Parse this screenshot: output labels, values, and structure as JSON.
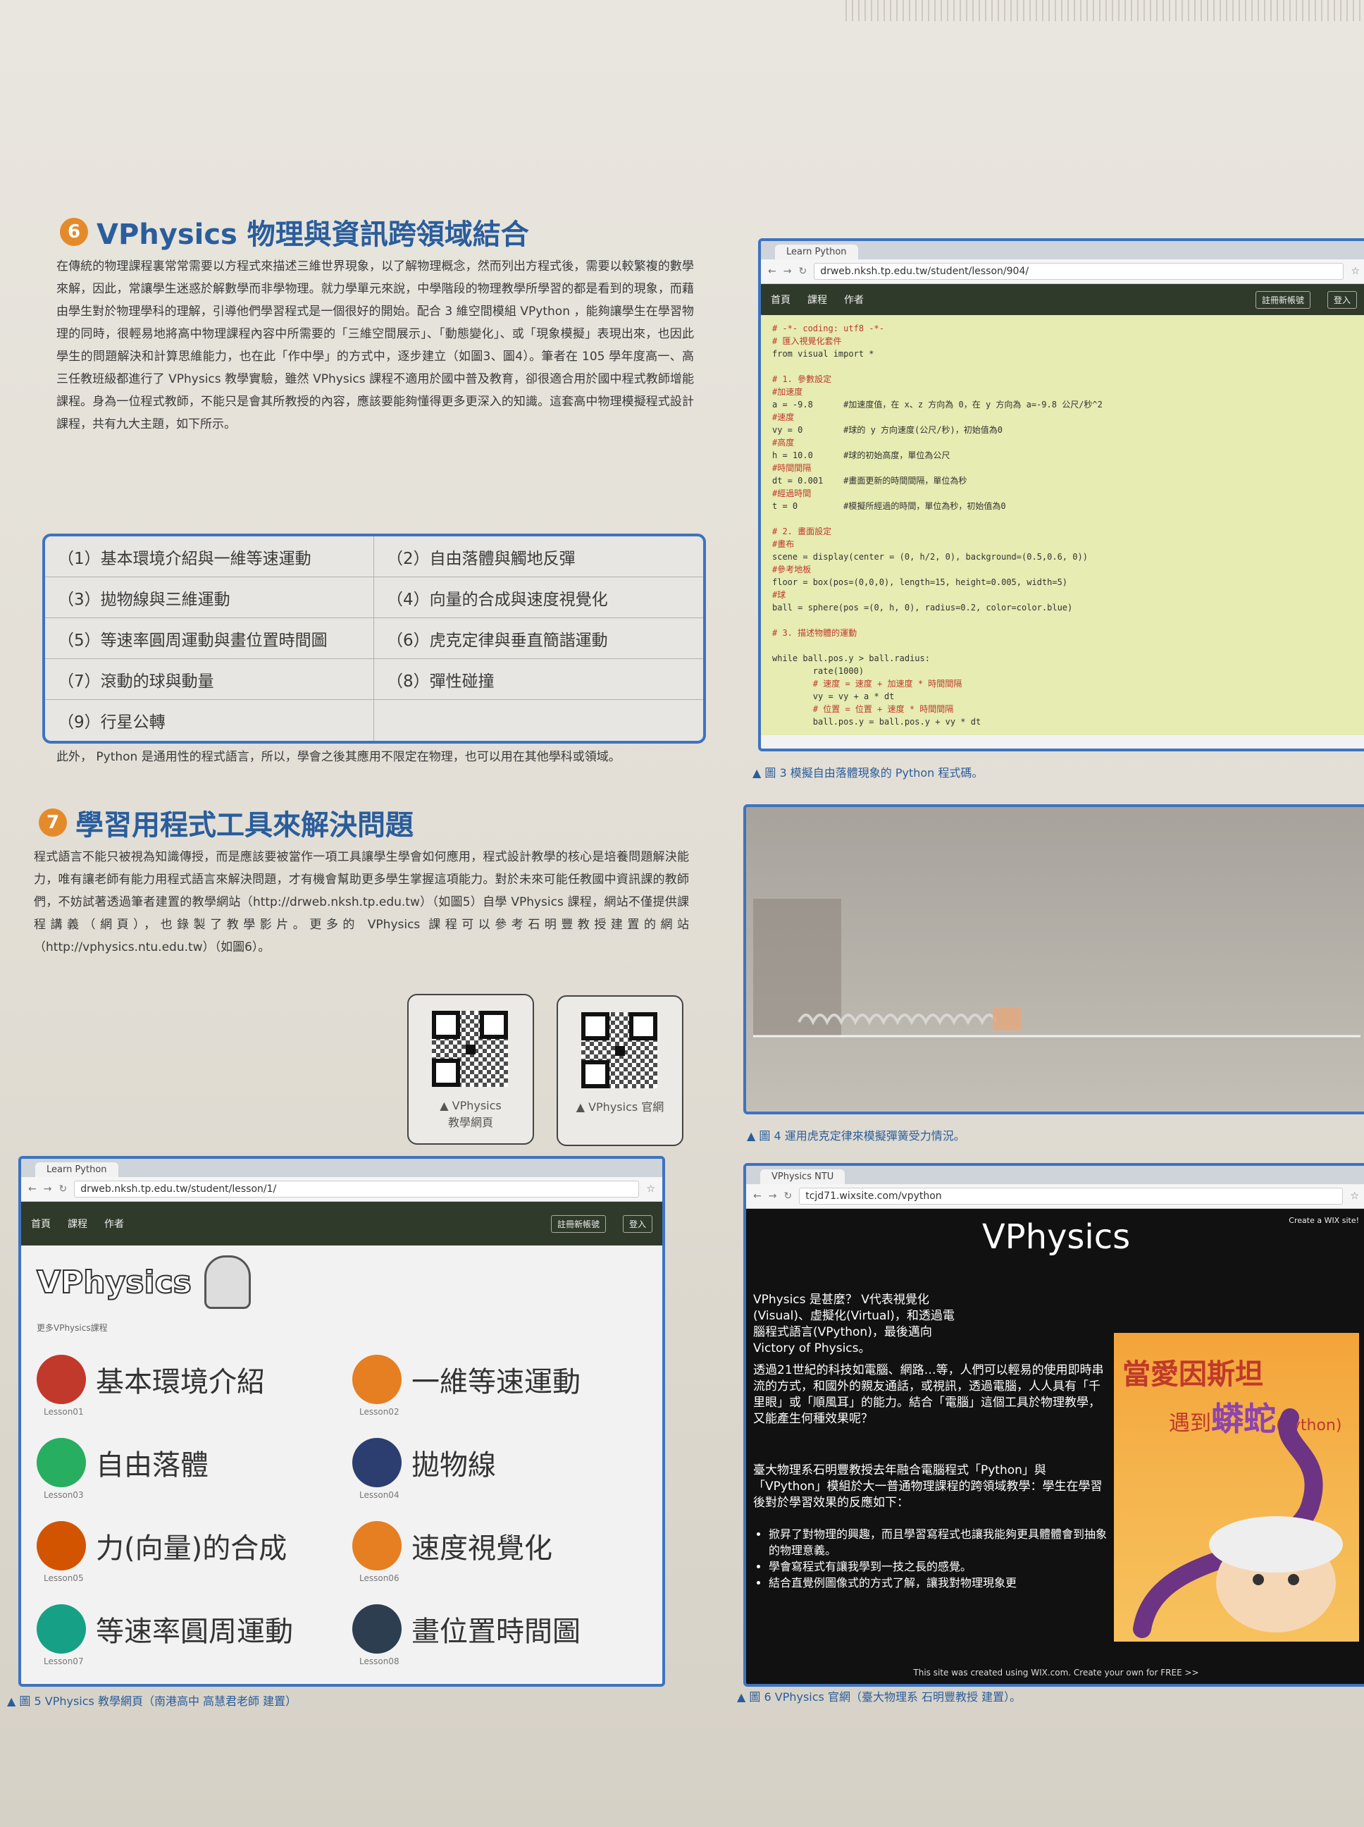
{
  "section6": {
    "number": "6",
    "title": "VPhysics 物理與資訊跨領域結合",
    "paragraph": "在傳統的物理課程裏常常需要以方程式來描述三維世界現象，以了解物理概念，然而列出方程式後，需要以較繁複的數學來解，因此，常讓學生迷惑於解數學而非學物理。就力學單元來說，中學階段的物理教學所學習的都是看到的現象，而藉由學生對於物理學科的理解，引導他們學習程式是一個很好的開始。配合 3 維空間模組 VPython ，能夠讓學生在學習物理的同時，很輕易地將高中物理課程內容中所需要的「三維空間展示」、「動態變化」、或「現象模擬」表現出來，也因此學生的問題解決和計算思維能力，也在此「作中學」的方式中，逐步建立（如圖3、圖4）。筆者在 105 學年度高一、高三任教班級都進行了 VPhysics 教學實驗，雖然 VPhysics 課程不適用於國中普及教育，卻很適合用於國中程式教師增能課程。身為一位程式教師，不能只是會其所教授的內容，應該要能夠懂得更多更深入的知識。這套高中物理模擬程式設計課程，共有九大主題，如下所示。"
  },
  "topics": [
    "（1）基本環境介紹與一維等速運動",
    "（2）自由落體與觸地反彈",
    "（3）拋物線與三維運動",
    "（4）向量的合成與速度視覺化",
    "（5）等速率圓周運動與畫位置時間圖",
    "（6）虎克定律與垂直簡諧運動",
    "（7）滾動的球與動量",
    "（8）彈性碰撞",
    "（9）行星公轉",
    ""
  ],
  "after_topics": "此外， Python 是通用性的程式語言，所以，學會之後其應用不限定在物理，也可以用在其他學科或領域。",
  "section7": {
    "number": "7",
    "title": "學習用程式工具來解決問題",
    "paragraph": "程式語言不能只被視為知識傳授，而是應該要被當作一項工具讓學生學會如何應用，程式設計教學的核心是培養問題解決能力，唯有讓老師有能力用程式語言來解決問題，才有機會幫助更多學生掌握這項能力。對於未來可能任教國中資訊課的教師們，不妨試著透過筆者建置的教學網站（http://drweb.nksh.tp.edu.tw）（如圖5）自學 VPhysics 課程，網站不僅提供課程講義（網頁），也錄製了教學影片。更多的 VPhysics 課程可以參考石明豐教授建置的網站（http://vphysics.ntu.edu.tw）（如圖6）。"
  },
  "qr_codes": [
    {
      "label_line1": "▲ VPhysics",
      "label_line2": "教學網頁"
    },
    {
      "label_line1": "▲ VPhysics 官網",
      "label_line2": ""
    }
  ],
  "fig3": {
    "tab": "Learn Python",
    "url": "drweb.nksh.tp.edu.tw/student/lesson/904/",
    "nav": [
      "首頁",
      "課程",
      "作者"
    ],
    "nav_buttons": [
      "註冊新帳號",
      "登入"
    ],
    "code_lines": [
      "# -*- coding: utf8 -*-",
      "# 匯入視覺化套件",
      "from visual import *",
      "",
      "# 1. 參數設定",
      "#加速度",
      "a = -9.8      #加速度值，在 x、z 方向為 0，在 y 方向為 a=-9.8 公尺/秒^2",
      "#速度",
      "vy = 0        #球的 y 方向速度(公尺/秒)，初始值為0",
      "#高度",
      "h = 10.0      #球的初始高度，單位為公尺",
      "#時間間隔",
      "dt = 0.001    #畫面更新的時間間隔，單位為秒",
      "#經過時間",
      "t = 0         #模擬所經過的時間，單位為秒，初始值為0",
      "",
      "# 2. 畫面設定",
      "#畫布",
      "scene = display(center = (0, h/2, 0), background=(0.5,0.6, 0))",
      "#參考地板",
      "floor = box(pos=(0,0,0), length=15, height=0.005, width=5)",
      "#球",
      "ball = sphere(pos =(0, h, 0), radius=0.2, color=color.blue)",
      "",
      "# 3. 描述物體的運動",
      "",
      "while ball.pos.y > ball.radius:",
      "        rate(1000)",
      "        # 速度 = 速度 + 加速度 * 時間間隔",
      "        vy = vy + a * dt",
      "        # 位置 = 位置 + 速度 * 時間間隔",
      "        ball.pos.y = ball.pos.y + vy * dt"
    ],
    "caption": "▲ 圖 3  模擬自由落體現象的 Python 程式碼。"
  },
  "fig4": {
    "caption": "▲ 圖 4  運用虎克定律來模擬彈簧受力情況。"
  },
  "fig5": {
    "tab": "Learn Python",
    "url": "drweb.nksh.tp.edu.tw/student/lesson/1/",
    "nav": [
      "首頁",
      "課程",
      "作者"
    ],
    "nav_buttons": [
      "註冊新帳號",
      "登入"
    ],
    "logo": "VPhysics",
    "subtitle": "更多VPhysics課程",
    "lessons": [
      {
        "title": "基本環境介紹",
        "code": "Lesson01",
        "color": "#c0392b"
      },
      {
        "title": "一維等速運動",
        "code": "Lesson02",
        "color": "#e67e22"
      },
      {
        "title": "自由落體",
        "code": "Lesson03",
        "color": "#27ae60"
      },
      {
        "title": "拋物線",
        "code": "Lesson04",
        "color": "#2c3e70"
      },
      {
        "title": "力(向量)的合成",
        "code": "Lesson05",
        "color": "#d35400"
      },
      {
        "title": "速度視覺化",
        "code": "Lesson06",
        "color": "#e67e22"
      },
      {
        "title": "等速率圓周運動",
        "code": "Lesson07",
        "color": "#16a085"
      },
      {
        "title": "畫位置時間圖",
        "code": "Lesson08",
        "color": "#2c3e50"
      }
    ],
    "caption": "▲ 圖 5  VPhysics 教學網頁（南港高中 高慧君老師 建置）"
  },
  "fig6": {
    "tab": "VPhysics NTU",
    "url": "tcjd71.wixsite.com/vpython",
    "title": "VPhysics",
    "wix_badge": "Create a WIX site!",
    "intro": "VPhysics 是甚麼？ V代表視覺化(Visual)、虛擬化(Virtual)，和透過電腦程式語言(VPython)，最後邁向Victory of Physics。",
    "para2": "透過21世紀的科技如電腦、網路…等，人們可以輕易的使用即時串流的方式，和國外的親友通話，或視訊，透過電腦，人人具有「千里眼」或「順風耳」的能力。結合「電腦」這個工具於物理教學，又能產生何種效果呢？",
    "para3": "臺大物理系石明豐教授去年融合電腦程式「Python」與「VPython」模組於大一普通物理課程的跨領域教學：學生在學習後對於學習效果的反應如下：",
    "bullets": [
      "掀昇了對物理的興趣，而且學習寫程式也讓我能夠更具體體會到抽象的物理意義。",
      "學會寫程式有讓我學到一技之長的感覺。",
      "結合直覺例圖像式的方式了解，讓我對物理現象更"
    ],
    "book_title_1": "當愛因斯坦",
    "book_title_2": "遇到",
    "book_title_3": "蟒蛇",
    "book_title_4": "(Python)",
    "footer": "This site was created using WIX.com. Create your own for FREE >>",
    "caption": "▲ 圖 6  VPhysics 官網（臺大物理系 石明豐教授 建置）。"
  }
}
